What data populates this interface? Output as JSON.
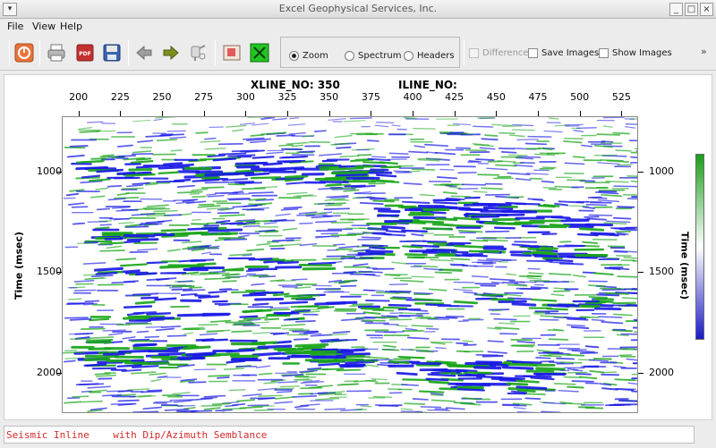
{
  "window": {
    "title": "Excel Geophysical Services, Inc.",
    "controls": [
      "_",
      "□",
      "×"
    ]
  },
  "menu": [
    {
      "label": "File"
    },
    {
      "label": "View"
    },
    {
      "label": "Help"
    }
  ],
  "toolbar": {
    "icons": [
      "power-icon",
      "printer-icon",
      "pdf-icon",
      "save-disk-icon",
      "arrow-left-icon",
      "arrow-right-icon",
      "probe-icon",
      "image-icon",
      "close-x-icon"
    ],
    "modes": [
      {
        "label": "Zoom",
        "selected": true
      },
      {
        "label": "Spectrum",
        "selected": false
      },
      {
        "label": "Headers",
        "selected": false
      }
    ],
    "checks": [
      {
        "label": "Difference",
        "checked": false,
        "enabled": false
      },
      {
        "label": "Save Images",
        "checked": false,
        "enabled": true
      },
      {
        "label": "Show Images",
        "checked": false,
        "enabled": true
      }
    ],
    "overflow": "»"
  },
  "plot": {
    "xline_label": "XLINE_NO: 350",
    "iline_label": "ILINE_NO:",
    "x_ticks": [
      "200",
      "225",
      "250",
      "275",
      "300",
      "325",
      "350",
      "375",
      "400",
      "425",
      "450",
      "475",
      "500",
      "525"
    ],
    "x_range": [
      190,
      535
    ],
    "y_ticks": [
      "1000",
      "1500",
      "2000"
    ],
    "y_range": [
      725,
      2200
    ],
    "y_label_left": "Time (msec)",
    "y_label_right": "Time (msec)",
    "colors": {
      "positive": "#1aa51a",
      "negative": "#1a1ae6",
      "background": "#ffffff"
    }
  },
  "status": {
    "text": "Seismic Inline    with Dip/Azimuth Semblance"
  }
}
